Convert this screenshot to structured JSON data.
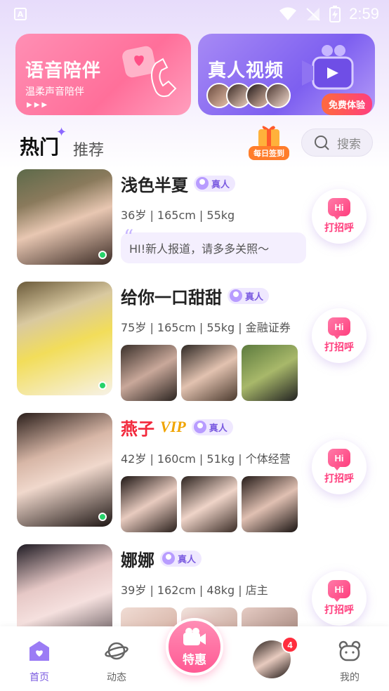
{
  "status_bar": {
    "time": "2:59"
  },
  "banners": {
    "voice": {
      "title": "语音陪伴",
      "subtitle": "温柔声音陪伴",
      "dots": "▶▶▶"
    },
    "video": {
      "title": "真人视频",
      "badge": "免费体验"
    }
  },
  "tabs": {
    "hot": "热门",
    "recommend": "推荐"
  },
  "checkin": {
    "label": "每日签到"
  },
  "search": {
    "label": "搜索"
  },
  "real_badge": "真人",
  "greet_label": "打招呼",
  "hi_text": "Hi",
  "profiles": [
    {
      "name": "浅色半夏",
      "stats": "36岁 | 165cm | 55kg",
      "greeting": "HI!新人报道，请多多关照～",
      "online": true
    },
    {
      "name": "给你一口甜甜",
      "stats": "75岁 | 165cm | 55kg | 金融证券",
      "online": true
    },
    {
      "name": "燕子",
      "vip": "VIP",
      "stats": "42岁 | 160cm | 51kg | 个体经营",
      "online": true
    },
    {
      "name": "娜娜",
      "stats": "39岁 | 162cm | 48kg | 店主",
      "online": false
    }
  ],
  "bottom_nav": {
    "home": "首页",
    "moments": "动态",
    "special": "特惠",
    "message_badge": "4",
    "mine": "我的"
  },
  "colors": {
    "accent": "#7a5ae0",
    "pink": "#ff3f7e",
    "vip_red": "#f2283b",
    "online": "#27d36b"
  }
}
